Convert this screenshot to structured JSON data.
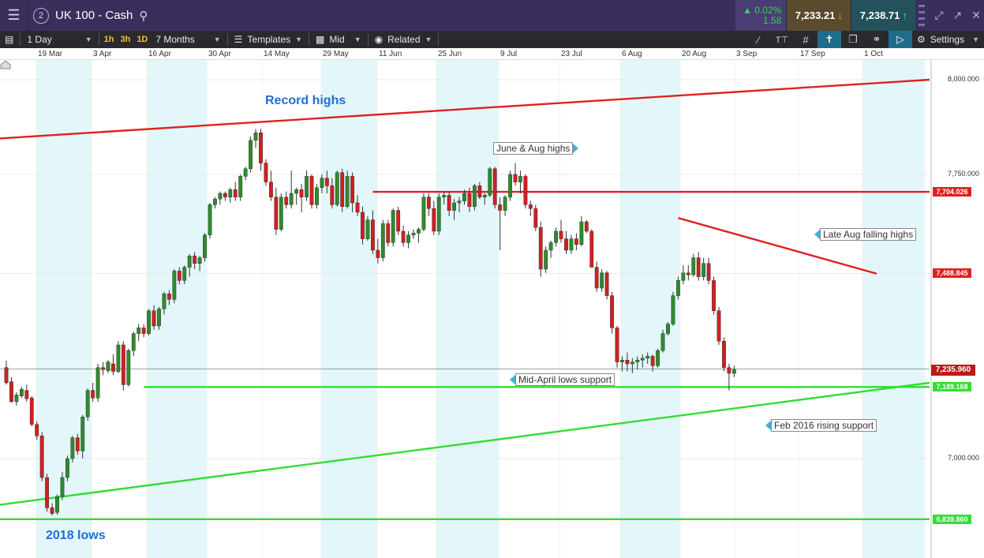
{
  "window": {
    "badge": "2",
    "title": "UK 100 - Cash",
    "change_percent": "0.02%",
    "change_points": "1.58",
    "sell_price": "7,233.21",
    "buy_price": "7,238.71"
  },
  "icons": {
    "menu": "hamburger-icon",
    "search": "search-icon",
    "sell_arrow": "down-arrow-icon",
    "buy_arrow": "up-arrow-icon",
    "home": "home-icon"
  },
  "toolbar": {
    "interval": "1 Day",
    "tf_1h": "1h",
    "tf_3h": "3h",
    "tf_1d": "1D",
    "range": "7 Months",
    "templates": "Templates",
    "price_type": "Mid",
    "related": "Related",
    "settings": "Settings"
  },
  "colors": {
    "up_candle": "#2e8b2e",
    "down_candle": "#d02020",
    "resistance": "#e02020",
    "support": "#33dd33",
    "shade": "#e3f7fb",
    "annotation_text": "#1d6fd6"
  },
  "chart_data": {
    "type": "candlestick",
    "instrument": "UK 100 - Cash",
    "date_ticks": [
      "19 Mar",
      "3 Apr",
      "16 Apr",
      "30 Apr",
      "14 May",
      "29 May",
      "11 Jun",
      "25 Jun",
      "9 Jul",
      "23 Jul",
      "6 Aug",
      "20 Aug",
      "3 Sep",
      "17 Sep",
      "1 Oct"
    ],
    "price_ticks": [
      {
        "label": "8,000.000",
        "value": 8000
      },
      {
        "label": "7,750.000",
        "value": 7750
      },
      {
        "label": "7,000.000",
        "value": 7000
      }
    ],
    "price_tags": [
      {
        "label": "7,704.026",
        "value": 7704.026,
        "kind": "resistance"
      },
      {
        "label": "7,488.845",
        "value": 7488.845,
        "kind": "resistance"
      },
      {
        "label": "7,235.960",
        "value": 7235.96,
        "kind": "current"
      },
      {
        "label": "7,189.168",
        "value": 7189.168,
        "kind": "support"
      },
      {
        "label": "6,839.860",
        "value": 6839.86,
        "kind": "support"
      }
    ],
    "ylim": [
      6800,
      8040
    ],
    "annotations": {
      "record_highs": "Record highs",
      "june_aug_highs": "June & Aug highs",
      "late_aug_falling_highs": "Late Aug falling highs",
      "mid_april_lows_support": "Mid-April lows support",
      "feb_2016_rising_support": "Feb 2016 rising support",
      "lows_2018": "2018 lows"
    },
    "lines": [
      {
        "name": "Record highs trendline",
        "from": [
          0,
          7845
        ],
        "to": [
          178,
          8000
        ],
        "color": "resistance"
      },
      {
        "name": "June & Aug highs",
        "from": [
          72,
          7704
        ],
        "to": [
          178,
          7704
        ],
        "color": "resistance"
      },
      {
        "name": "Late Aug falling highs",
        "from": [
          132,
          7635
        ],
        "to": [
          171,
          7488
        ],
        "color": "resistance"
      },
      {
        "name": "Mid-April lows support",
        "from": [
          27,
          7189
        ],
        "to": [
          178,
          7189
        ],
        "color": "support"
      },
      {
        "name": "Feb 2016 rising support",
        "from": [
          0,
          6878
        ],
        "to": [
          178,
          7200
        ],
        "color": "support"
      },
      {
        "name": "2018 lows",
        "from": [
          0,
          6840
        ],
        "to": [
          178,
          6840
        ],
        "color": "support"
      }
    ],
    "candles": [
      [
        7240,
        7258,
        7195,
        7200
      ],
      [
        7203,
        7215,
        7148,
        7150
      ],
      [
        7150,
        7175,
        7140,
        7168
      ],
      [
        7165,
        7190,
        7160,
        7183
      ],
      [
        7180,
        7195,
        7150,
        7158
      ],
      [
        7160,
        7165,
        7085,
        7090
      ],
      [
        7090,
        7098,
        7050,
        7060
      ],
      [
        7060,
        7070,
        6940,
        6950
      ],
      [
        6950,
        6960,
        6860,
        6870
      ],
      [
        6870,
        6882,
        6850,
        6855
      ],
      [
        6858,
        6905,
        6852,
        6900
      ],
      [
        6900,
        6965,
        6890,
        6950
      ],
      [
        6950,
        7008,
        6940,
        7000
      ],
      [
        7000,
        7060,
        6990,
        7055
      ],
      [
        7055,
        7065,
        7010,
        7020
      ],
      [
        7020,
        7115,
        7000,
        7110
      ],
      [
        7110,
        7185,
        7100,
        7180
      ],
      [
        7180,
        7200,
        7150,
        7160
      ],
      [
        7160,
        7250,
        7150,
        7240
      ],
      [
        7240,
        7255,
        7220,
        7235
      ],
      [
        7232,
        7260,
        7225,
        7255
      ],
      [
        7250,
        7275,
        7220,
        7230
      ],
      [
        7230,
        7310,
        7225,
        7300
      ],
      [
        7300,
        7310,
        7180,
        7195
      ],
      [
        7195,
        7290,
        7190,
        7285
      ],
      [
        7285,
        7335,
        7270,
        7330
      ],
      [
        7330,
        7355,
        7310,
        7345
      ],
      [
        7345,
        7355,
        7320,
        7330
      ],
      [
        7330,
        7395,
        7325,
        7390
      ],
      [
        7390,
        7405,
        7340,
        7350
      ],
      [
        7350,
        7400,
        7340,
        7395
      ],
      [
        7395,
        7440,
        7380,
        7435
      ],
      [
        7435,
        7445,
        7405,
        7420
      ],
      [
        7420,
        7500,
        7410,
        7495
      ],
      [
        7495,
        7505,
        7460,
        7470
      ],
      [
        7470,
        7510,
        7460,
        7505
      ],
      [
        7505,
        7540,
        7480,
        7535
      ],
      [
        7535,
        7545,
        7500,
        7515
      ],
      [
        7515,
        7535,
        7495,
        7530
      ],
      [
        7530,
        7595,
        7520,
        7590
      ],
      [
        7590,
        7675,
        7580,
        7670
      ],
      [
        7670,
        7690,
        7660,
        7685
      ],
      [
        7685,
        7705,
        7670,
        7700
      ],
      [
        7700,
        7705,
        7680,
        7690
      ],
      [
        7690,
        7715,
        7675,
        7710
      ],
      [
        7710,
        7730,
        7680,
        7690
      ],
      [
        7690,
        7750,
        7680,
        7745
      ],
      [
        7745,
        7770,
        7735,
        7765
      ],
      [
        7765,
        7850,
        7755,
        7840
      ],
      [
        7840,
        7870,
        7820,
        7860
      ],
      [
        7860,
        7870,
        7760,
        7780
      ],
      [
        7780,
        7790,
        7720,
        7730
      ],
      [
        7730,
        7760,
        7680,
        7690
      ],
      [
        7690,
        7715,
        7590,
        7605
      ],
      [
        7605,
        7700,
        7600,
        7690
      ],
      [
        7690,
        7705,
        7660,
        7670
      ],
      [
        7670,
        7760,
        7660,
        7700
      ],
      [
        7700,
        7715,
        7670,
        7710
      ],
      [
        7710,
        7725,
        7650,
        7690
      ],
      [
        7690,
        7760,
        7680,
        7745
      ],
      [
        7745,
        7750,
        7660,
        7670
      ],
      [
        7670,
        7725,
        7660,
        7715
      ],
      [
        7715,
        7750,
        7700,
        7740
      ],
      [
        7740,
        7760,
        7700,
        7720
      ],
      [
        7720,
        7740,
        7660,
        7670
      ],
      [
        7670,
        7760,
        7665,
        7755
      ],
      [
        7755,
        7765,
        7650,
        7665
      ],
      [
        7665,
        7760,
        7660,
        7745
      ],
      [
        7745,
        7755,
        7650,
        7675
      ],
      [
        7675,
        7695,
        7640,
        7650
      ],
      [
        7650,
        7665,
        7565,
        7580
      ],
      [
        7580,
        7640,
        7575,
        7630
      ],
      [
        7630,
        7655,
        7540,
        7550
      ],
      [
        7550,
        7580,
        7515,
        7530
      ],
      [
        7530,
        7630,
        7520,
        7620
      ],
      [
        7620,
        7630,
        7560,
        7570
      ],
      [
        7570,
        7660,
        7560,
        7655
      ],
      [
        7655,
        7665,
        7590,
        7600
      ],
      [
        7600,
        7615,
        7560,
        7570
      ],
      [
        7570,
        7600,
        7555,
        7590
      ],
      [
        7590,
        7605,
        7580,
        7595
      ],
      [
        7595,
        7610,
        7570,
        7605
      ],
      [
        7605,
        7700,
        7600,
        7690
      ],
      [
        7690,
        7700,
        7640,
        7660
      ],
      [
        7660,
        7680,
        7590,
        7600
      ],
      [
        7600,
        7700,
        7590,
        7690
      ],
      [
        7690,
        7705,
        7670,
        7695
      ],
      [
        7695,
        7705,
        7640,
        7655
      ],
      [
        7655,
        7685,
        7630,
        7675
      ],
      [
        7675,
        7690,
        7650,
        7680
      ],
      [
        7680,
        7710,
        7670,
        7700
      ],
      [
        7700,
        7715,
        7650,
        7665
      ],
      [
        7665,
        7725,
        7655,
        7720
      ],
      [
        7720,
        7730,
        7685,
        7690
      ],
      [
        7690,
        7700,
        7670,
        7695
      ],
      [
        7695,
        7770,
        7690,
        7765
      ],
      [
        7765,
        7770,
        7660,
        7670
      ],
      [
        7670,
        7690,
        7550,
        7655
      ],
      [
        7655,
        7695,
        7640,
        7690
      ],
      [
        7690,
        7760,
        7680,
        7750
      ],
      [
        7750,
        7780,
        7720,
        7730
      ],
      [
        7730,
        7760,
        7700,
        7745
      ],
      [
        7745,
        7750,
        7660,
        7670
      ],
      [
        7670,
        7680,
        7640,
        7660
      ],
      [
        7660,
        7670,
        7600,
        7610
      ],
      [
        7610,
        7625,
        7480,
        7500
      ],
      [
        7500,
        7560,
        7490,
        7550
      ],
      [
        7550,
        7575,
        7530,
        7570
      ],
      [
        7570,
        7610,
        7560,
        7600
      ],
      [
        7600,
        7630,
        7570,
        7580
      ],
      [
        7580,
        7600,
        7540,
        7550
      ],
      [
        7550,
        7590,
        7540,
        7580
      ],
      [
        7580,
        7595,
        7550,
        7565
      ],
      [
        7565,
        7640,
        7560,
        7625
      ],
      [
        7625,
        7630,
        7595,
        7600
      ],
      [
        7600,
        7605,
        7540,
        7505
      ],
      [
        7505,
        7520,
        7440,
        7450
      ],
      [
        7450,
        7500,
        7440,
        7490
      ],
      [
        7490,
        7495,
        7420,
        7430
      ],
      [
        7430,
        7440,
        7330,
        7345
      ],
      [
        7345,
        7350,
        7240,
        7255
      ],
      [
        7255,
        7270,
        7230,
        7260
      ],
      [
        7260,
        7280,
        7230,
        7250
      ],
      [
        7250,
        7265,
        7225,
        7255
      ],
      [
        7255,
        7270,
        7235,
        7260
      ],
      [
        7260,
        7275,
        7240,
        7265
      ],
      [
        7265,
        7280,
        7250,
        7270
      ],
      [
        7270,
        7275,
        7230,
        7245
      ],
      [
        7245,
        7290,
        7240,
        7285
      ],
      [
        7285,
        7340,
        7280,
        7330
      ],
      [
        7330,
        7360,
        7325,
        7355
      ],
      [
        7355,
        7440,
        7350,
        7430
      ],
      [
        7430,
        7480,
        7420,
        7470
      ],
      [
        7470,
        7510,
        7460,
        7490
      ],
      [
        7490,
        7510,
        7470,
        7485
      ],
      [
        7485,
        7540,
        7480,
        7530
      ],
      [
        7530,
        7545,
        7470,
        7480
      ],
      [
        7480,
        7530,
        7470,
        7515
      ],
      [
        7515,
        7530,
        7460,
        7470
      ],
      [
        7470,
        7480,
        7380,
        7390
      ],
      [
        7390,
        7400,
        7300,
        7310
      ],
      [
        7310,
        7320,
        7230,
        7240
      ],
      [
        7240,
        7250,
        7180,
        7225
      ],
      [
        7225,
        7245,
        7215,
        7236
      ]
    ]
  }
}
